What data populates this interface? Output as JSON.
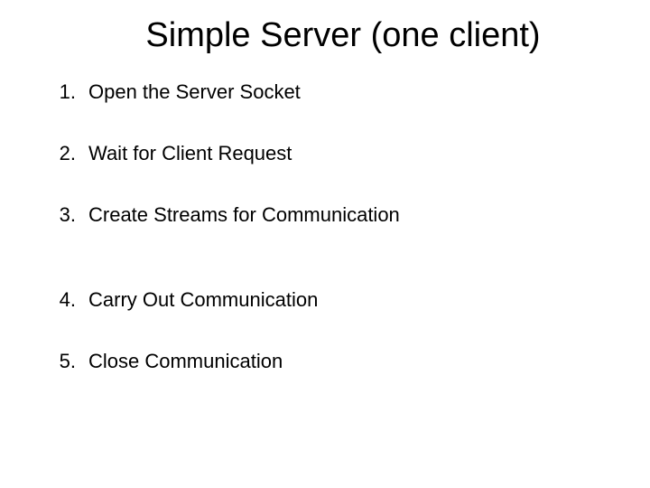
{
  "title": "Simple Server (one client)",
  "items": [
    {
      "num": "1.",
      "text": "Open the Server Socket"
    },
    {
      "num": "2.",
      "text": "Wait for Client Request"
    },
    {
      "num": "3.",
      "text": "Create Streams for Communication"
    },
    {
      "num": "4.",
      "text": "Carry Out Communication"
    },
    {
      "num": "5.",
      "text": "Close Communication"
    }
  ]
}
